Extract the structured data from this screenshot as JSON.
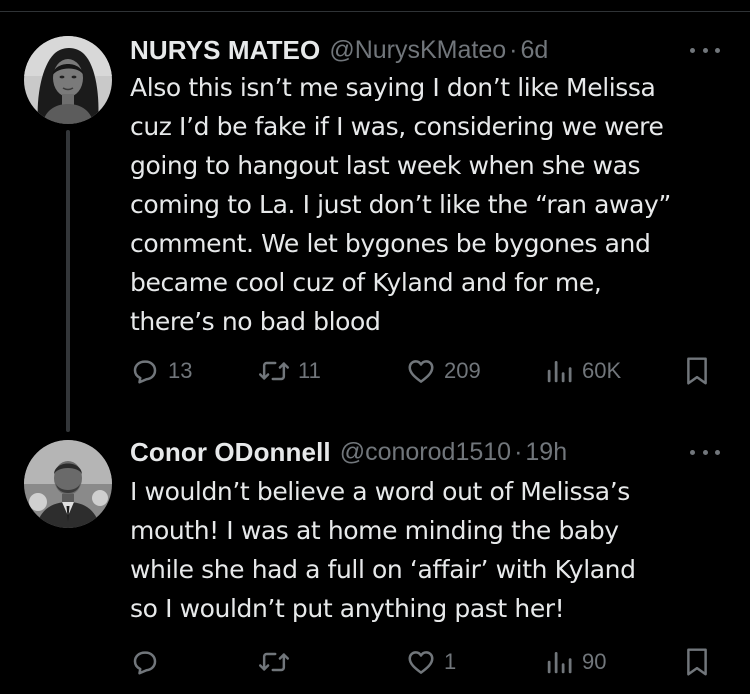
{
  "tweets": [
    {
      "display_name": "NURYS MATEO",
      "handle": "@NurysKMateo",
      "separator": "·",
      "time": "6d",
      "text_lines": [
        "Also this isn’t me saying I don’t like Melissa",
        "cuz I’d be fake if I was, considering we were",
        "going to hangout last week when she was",
        "coming to La. I just don’t like the “ran away”",
        "comment. We let bygones be bygones and",
        "became cool cuz of Kyland and for me,",
        "there’s no bad blood"
      ],
      "replies": "13",
      "reposts": "11",
      "likes": "209",
      "views": "60K",
      "icons": [
        "reply-icon",
        "repost-icon",
        "like-icon",
        "views-icon",
        "bookmark-icon",
        "more-icon"
      ]
    },
    {
      "display_name": "Conor ODonnell",
      "handle": "@conorod1510",
      "separator": "·",
      "time": "19h",
      "text_lines": [
        "I wouldn’t believe a word out of Melissa’s",
        "mouth! I was at home minding the baby",
        "while she had a full on ‘affair’ with Kyland",
        "so I wouldn’t put anything past her!"
      ],
      "replies": "",
      "reposts": "",
      "likes": "1",
      "views": "90",
      "icons": [
        "reply-icon",
        "repost-icon",
        "like-icon",
        "views-icon",
        "bookmark-icon",
        "more-icon"
      ]
    }
  ],
  "colors": {
    "background": "#000000",
    "primary_text": "#e7e9ea",
    "secondary_text": "#71767b",
    "thread_line": "#333639"
  }
}
